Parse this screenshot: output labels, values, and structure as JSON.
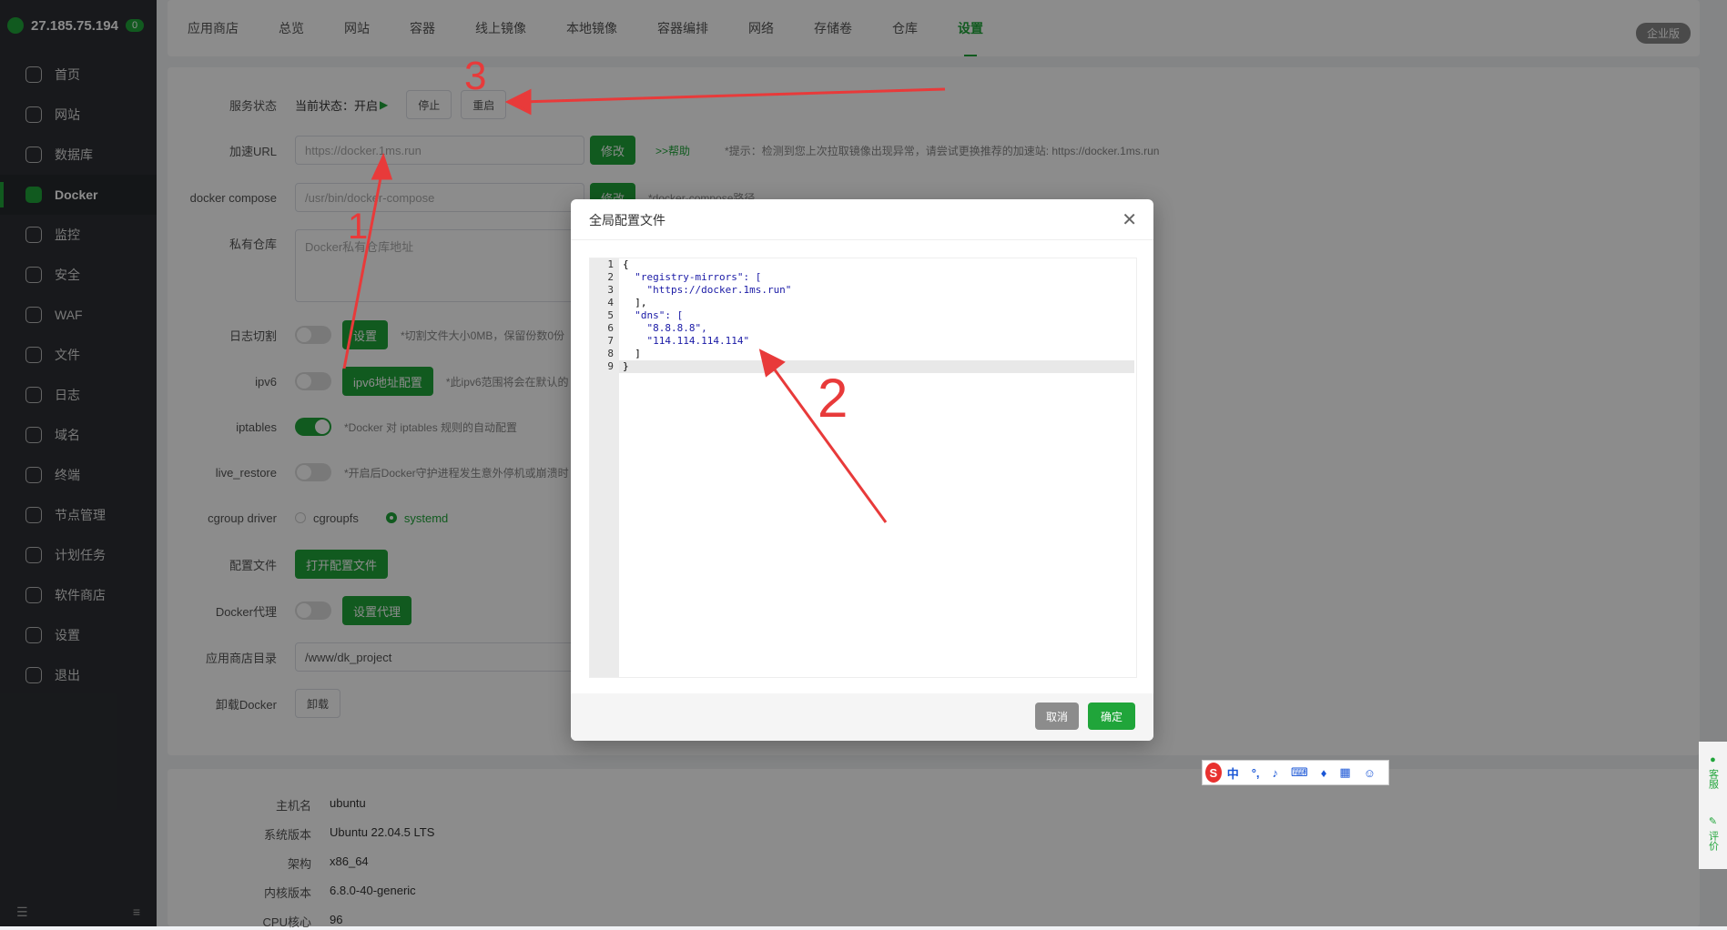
{
  "server": {
    "ip": "27.185.75.194",
    "badge": "0"
  },
  "sidebar": {
    "items": [
      {
        "label": "首页",
        "icon": "home-icon"
      },
      {
        "label": "网站",
        "icon": "globe-icon"
      },
      {
        "label": "数据库",
        "icon": "database-icon"
      },
      {
        "label": "Docker",
        "icon": "docker-icon"
      },
      {
        "label": "监控",
        "icon": "monitor-icon"
      },
      {
        "label": "安全",
        "icon": "shield-icon"
      },
      {
        "label": "WAF",
        "icon": "waf-icon"
      },
      {
        "label": "文件",
        "icon": "folder-icon"
      },
      {
        "label": "日志",
        "icon": "log-icon"
      },
      {
        "label": "域名",
        "icon": "domain-icon"
      },
      {
        "label": "终端",
        "icon": "terminal-icon"
      },
      {
        "label": "节点管理",
        "icon": "node-icon"
      },
      {
        "label": "计划任务",
        "icon": "calendar-icon"
      },
      {
        "label": "软件商店",
        "icon": "store-icon"
      },
      {
        "label": "设置",
        "icon": "gear-icon"
      },
      {
        "label": "退出",
        "icon": "logout-icon"
      }
    ]
  },
  "tabs": [
    "应用商店",
    "总览",
    "网站",
    "容器",
    "线上镜像",
    "本地镜像",
    "容器编排",
    "网络",
    "存储卷",
    "仓库",
    "设置"
  ],
  "enterprise_label": "企业版",
  "settings": {
    "service_status": {
      "label": "服务状态",
      "current": "当前状态：开启",
      "play": "▶",
      "stop": "停止",
      "restart": "重启"
    },
    "accel_url": {
      "label": "加速URL",
      "placeholder": "https://docker.1ms.run",
      "modify": "修改",
      "help": ">>帮助",
      "hint": "*提示：检测到您上次拉取镜像出现异常，请尝试更换推荐的加速站: https://docker.1ms.run"
    },
    "compose": {
      "label": "docker compose",
      "value": "/usr/bin/docker-compose",
      "modify": "修改",
      "hint": "*docker-compose路径"
    },
    "private_repo": {
      "label": "私有仓库",
      "placeholder": "Docker私有仓库地址"
    },
    "log_cut": {
      "label": "日志切割",
      "button": "设置",
      "hint": "*切割文件大小0MB，保留份数0份"
    },
    "ipv6": {
      "label": "ipv6",
      "button": "ipv6地址配置",
      "hint": "*此ipv6范围将会在默认的"
    },
    "iptables": {
      "label": "iptables",
      "hint": "*Docker 对 iptables 规则的自动配置"
    },
    "live_restore": {
      "label": "live_restore",
      "hint": "*开启后Docker守护进程发生意外停机或崩溃时"
    },
    "cgroup": {
      "label": "cgroup driver",
      "opt1": "cgroupfs",
      "opt2": "systemd"
    },
    "config_file": {
      "label": "配置文件",
      "button": "打开配置文件"
    },
    "proxy": {
      "label": "Docker代理",
      "button": "设置代理"
    },
    "app_dir": {
      "label": "应用商店目录",
      "value": "/www/dk_project"
    },
    "uninstall": {
      "label": "卸载Docker",
      "button": "卸载"
    }
  },
  "info": [
    {
      "label": "主机名",
      "value": "ubuntu"
    },
    {
      "label": "系统版本",
      "value": "Ubuntu 22.04.5 LTS"
    },
    {
      "label": "架构",
      "value": "x86_64"
    },
    {
      "label": "内核版本",
      "value": "6.8.0-40-generic"
    },
    {
      "label": "CPU核心",
      "value": "96"
    }
  ],
  "modal": {
    "title": "全局配置文件",
    "close": "✕",
    "lines": [
      "{",
      "  \"registry-mirrors\": [",
      "    \"https://docker.1ms.run\"",
      "  ],",
      "  \"dns\": [",
      "    \"8.8.8.8\",",
      "    \"114.114.114.114\"",
      "  ]",
      "}"
    ],
    "cancel": "取消",
    "ok": "确定"
  },
  "ime": {
    "logo": "S",
    "lang": "中",
    "punct": "°,"
  },
  "float": {
    "service": "客服",
    "review": "评价"
  },
  "annotations": [
    "1",
    "2",
    "3"
  ],
  "colors": {
    "brand": "#20a53a",
    "sidebar": "#2c2f33",
    "arrow": "#e83a3a"
  }
}
